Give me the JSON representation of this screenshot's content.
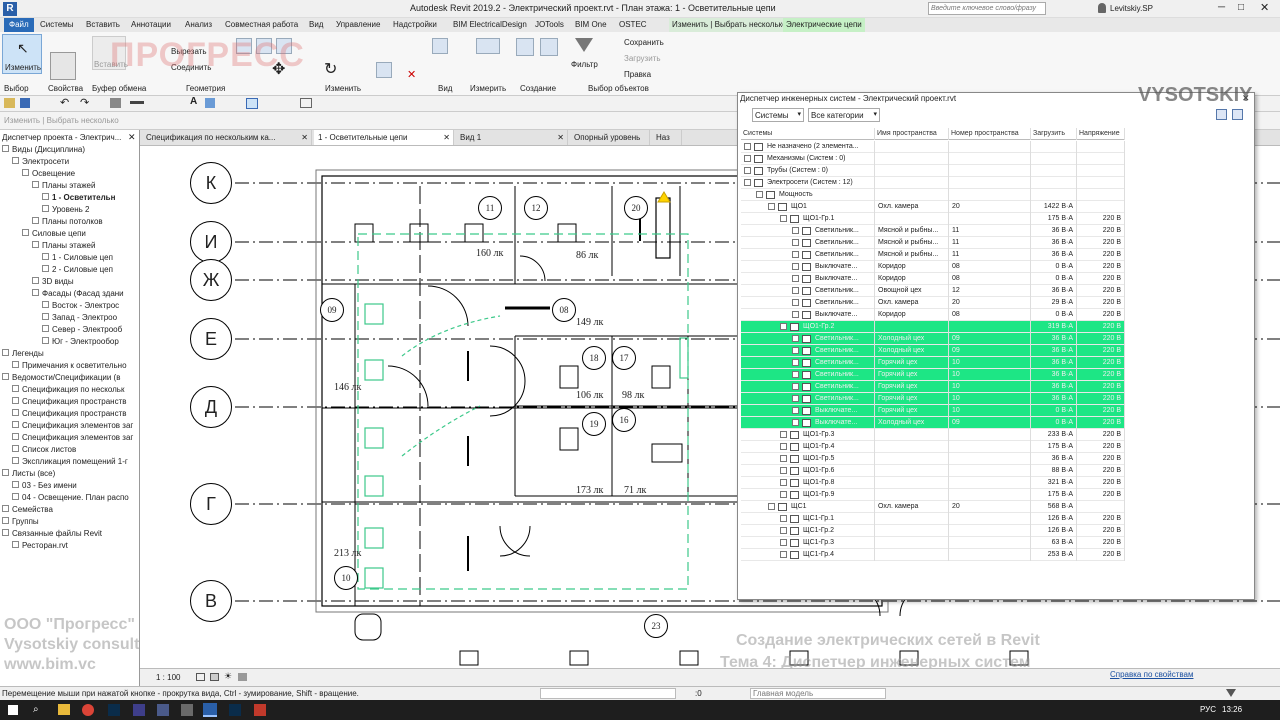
{
  "window": {
    "title": "Autodesk Revit 2019.2 - Электрический проект.rvt - План этажа: 1 - Осветительные цепи",
    "search_placeholder": "Введите ключевое слово/фразу",
    "user": "Levitskiy.SP"
  },
  "menu": [
    "Файл",
    "Системы",
    "Вставить",
    "Аннотации",
    "Анализ",
    "Совместная работа",
    "Вид",
    "Управление",
    "Надстройки",
    "BIM ElectricalDesign",
    "JOTools",
    "BIM One",
    "OSTEC",
    "Изменить | Выбрать несколько",
    "Электрические цепи"
  ],
  "ribbon": {
    "modify_label": "Изменить",
    "paste_label": "Вставить",
    "cut_label": "Вырезать",
    "join_label": "Соединить",
    "save_label": "Сохранить",
    "load_label": "Загрузить",
    "edit_label": "Правка",
    "filter_label": "Фильтр",
    "panels": [
      "Выбор",
      "Свойства",
      "Буфер обмена",
      "Геометрия",
      "Изменить",
      "Вид",
      "Измерить",
      "Создание",
      "Выбор объектов"
    ]
  },
  "optbar_text": "Изменить | Выбрать несколько",
  "browser": {
    "title": "Диспетчер проекта - Электрич...",
    "items": [
      {
        "t": "Виды (Дисциплина)",
        "d": 0,
        "sel": false
      },
      {
        "t": "Электросети",
        "d": 1,
        "sel": false
      },
      {
        "t": "Освещение",
        "d": 2,
        "sel": false
      },
      {
        "t": "Планы этажей",
        "d": 3,
        "sel": false
      },
      {
        "t": "1 - Осветительн",
        "d": 4,
        "sel": true
      },
      {
        "t": "Уровень 2",
        "d": 4,
        "sel": false
      },
      {
        "t": "Планы потолков",
        "d": 3,
        "sel": false
      },
      {
        "t": "Силовые цепи",
        "d": 2,
        "sel": false
      },
      {
        "t": "Планы этажей",
        "d": 3,
        "sel": false
      },
      {
        "t": "1 - Силовые цеп",
        "d": 4,
        "sel": false
      },
      {
        "t": "2 - Силовые цеп",
        "d": 4,
        "sel": false
      },
      {
        "t": "3D виды",
        "d": 3,
        "sel": false
      },
      {
        "t": "Фасады (Фасад здани",
        "d": 3,
        "sel": false
      },
      {
        "t": "Восток - Электрос",
        "d": 4,
        "sel": false
      },
      {
        "t": "Запад - Электроо",
        "d": 4,
        "sel": false
      },
      {
        "t": "Север - Электрооб",
        "d": 4,
        "sel": false
      },
      {
        "t": "Юг - Электрообор",
        "d": 4,
        "sel": false
      },
      {
        "t": "Легенды",
        "d": 0,
        "sel": false
      },
      {
        "t": "Примечания к осветительно",
        "d": 1,
        "sel": false
      },
      {
        "t": "Ведомости/Спецификации (в",
        "d": 0,
        "sel": false
      },
      {
        "t": "Спецификация по нескольк",
        "d": 1,
        "sel": false
      },
      {
        "t": "Спецификация пространств",
        "d": 1,
        "sel": false
      },
      {
        "t": "Спецификация пространств",
        "d": 1,
        "sel": false
      },
      {
        "t": "Спецификация элементов заг",
        "d": 1,
        "sel": false
      },
      {
        "t": "Спецификация элементов заг",
        "d": 1,
        "sel": false
      },
      {
        "t": "Список листов",
        "d": 1,
        "sel": false
      },
      {
        "t": "Экспликация помещений 1-г",
        "d": 1,
        "sel": false
      },
      {
        "t": "Листы (все)",
        "d": 0,
        "sel": false
      },
      {
        "t": "03 - Без имени",
        "d": 1,
        "sel": false
      },
      {
        "t": "04 - Освещение. План распо",
        "d": 1,
        "sel": false
      },
      {
        "t": "Семейства",
        "d": 0,
        "sel": false
      },
      {
        "t": "Группы",
        "d": 0,
        "sel": false
      },
      {
        "t": "Связанные файлы Revit",
        "d": 0,
        "sel": false
      },
      {
        "t": "Ресторан.rvt",
        "d": 1,
        "sel": false
      }
    ]
  },
  "tabs": [
    "Спецификация по нескольким ка...",
    "1 - Осветительные цепи",
    "Вид 1",
    "Опорный уровень",
    "Наз"
  ],
  "plan": {
    "grid": [
      "К",
      "И",
      "Ж",
      "Е",
      "Д",
      "Г",
      "В"
    ],
    "rooms": [
      "11",
      "12",
      "20",
      "09",
      "08",
      "18",
      "17",
      "19",
      "16",
      "10",
      "23"
    ],
    "lux": [
      "160 лк",
      "86 лк",
      "149 лк",
      "146 лк",
      "106 лк",
      "98 лк",
      "173 лк",
      "71 лк",
      "213 лк"
    ],
    "scale": "1 : 100"
  },
  "sysmgr": {
    "title": "Диспетчер инженерных систем - Электрический проект.rvt",
    "filter1": "Системы",
    "filter2": "Все категории",
    "headers": [
      "Системы",
      "Имя пространства",
      "Номер пространства",
      "Загрузить",
      "Напряжение"
    ],
    "rows": [
      {
        "d": 0,
        "n": "Не назначено (2 элемента...",
        "s": "",
        "num": "",
        "load": "",
        "v": "",
        "hl": false
      },
      {
        "d": 0,
        "n": "Механизмы (Систем : 0)",
        "s": "",
        "num": "",
        "load": "",
        "v": "",
        "hl": false
      },
      {
        "d": 0,
        "n": "Трубы (Систем : 0)",
        "s": "",
        "num": "",
        "load": "",
        "v": "",
        "hl": false
      },
      {
        "d": 0,
        "n": "Электросети (Систем : 12)",
        "s": "",
        "num": "",
        "load": "",
        "v": "",
        "hl": false
      },
      {
        "d": 1,
        "n": "Мощность",
        "s": "",
        "num": "",
        "load": "",
        "v": "",
        "hl": false
      },
      {
        "d": 2,
        "n": "ЩО1",
        "s": "Охл. камера",
        "num": "20",
        "load": "1422 В·А",
        "v": "",
        "hl": false
      },
      {
        "d": 3,
        "n": "ЩО1-Гр.1",
        "s": "",
        "num": "",
        "load": "175 В·А",
        "v": "220 В",
        "hl": false
      },
      {
        "d": 4,
        "n": "Светильник...",
        "s": "Мясной и рыбны...",
        "num": "11",
        "load": "36 В·А",
        "v": "220 В",
        "hl": false
      },
      {
        "d": 4,
        "n": "Светильник...",
        "s": "Мясной и рыбны...",
        "num": "11",
        "load": "36 В·А",
        "v": "220 В",
        "hl": false
      },
      {
        "d": 4,
        "n": "Светильник...",
        "s": "Мясной и рыбны...",
        "num": "11",
        "load": "36 В·А",
        "v": "220 В",
        "hl": false
      },
      {
        "d": 4,
        "n": "Выключате...",
        "s": "Коридор",
        "num": "08",
        "load": "0 В·А",
        "v": "220 В",
        "hl": false
      },
      {
        "d": 4,
        "n": "Выключате...",
        "s": "Коридор",
        "num": "08",
        "load": "0 В·А",
        "v": "220 В",
        "hl": false
      },
      {
        "d": 4,
        "n": "Светильник...",
        "s": "Овощной цех",
        "num": "12",
        "load": "36 В·А",
        "v": "220 В",
        "hl": false
      },
      {
        "d": 4,
        "n": "Светильник...",
        "s": "Охл. камера",
        "num": "20",
        "load": "29 В·А",
        "v": "220 В",
        "hl": false
      },
      {
        "d": 4,
        "n": "Выключате...",
        "s": "Коридор",
        "num": "08",
        "load": "0 В·А",
        "v": "220 В",
        "hl": false
      },
      {
        "d": 3,
        "n": "ЩО1-Гр.2",
        "s": "",
        "num": "",
        "load": "319 В·А",
        "v": "220 В",
        "hl": true
      },
      {
        "d": 4,
        "n": "Светильник...",
        "s": "Холодный цех",
        "num": "09",
        "load": "36 В·А",
        "v": "220 В",
        "hl": true
      },
      {
        "d": 4,
        "n": "Светильник...",
        "s": "Холодный цех",
        "num": "09",
        "load": "36 В·А",
        "v": "220 В",
        "hl": true
      },
      {
        "d": 4,
        "n": "Светильник...",
        "s": "Горячий цех",
        "num": "10",
        "load": "36 В·А",
        "v": "220 В",
        "hl": true
      },
      {
        "d": 4,
        "n": "Светильник...",
        "s": "Горячий цех",
        "num": "10",
        "load": "36 В·А",
        "v": "220 В",
        "hl": true
      },
      {
        "d": 4,
        "n": "Светильник...",
        "s": "Горячий цех",
        "num": "10",
        "load": "36 В·А",
        "v": "220 В",
        "hl": true
      },
      {
        "d": 4,
        "n": "Светильник...",
        "s": "Горячий цех",
        "num": "10",
        "load": "36 В·А",
        "v": "220 В",
        "hl": true
      },
      {
        "d": 4,
        "n": "Выключате...",
        "s": "Горячий цех",
        "num": "10",
        "load": "0 В·А",
        "v": "220 В",
        "hl": true
      },
      {
        "d": 4,
        "n": "Выключате...",
        "s": "Холодный цех",
        "num": "09",
        "load": "0 В·А",
        "v": "220 В",
        "hl": true
      },
      {
        "d": 3,
        "n": "ЩО1-Гр.3",
        "s": "",
        "num": "",
        "load": "233 В·А",
        "v": "220 В",
        "hl": false
      },
      {
        "d": 3,
        "n": "ЩО1-Гр.4",
        "s": "",
        "num": "",
        "load": "175 В·А",
        "v": "220 В",
        "hl": false
      },
      {
        "d": 3,
        "n": "ЩО1-Гр.5",
        "s": "",
        "num": "",
        "load": "36 В·А",
        "v": "220 В",
        "hl": false
      },
      {
        "d": 3,
        "n": "ЩО1-Гр.6",
        "s": "",
        "num": "",
        "load": "88 В·А",
        "v": "220 В",
        "hl": false
      },
      {
        "d": 3,
        "n": "ЩО1-Гр.8",
        "s": "",
        "num": "",
        "load": "321 В·А",
        "v": "220 В",
        "hl": false
      },
      {
        "d": 3,
        "n": "ЩО1-Гр.9",
        "s": "",
        "num": "",
        "load": "175 В·А",
        "v": "220 В",
        "hl": false
      },
      {
        "d": 2,
        "n": "ЩС1",
        "s": "Охл. камера",
        "num": "20",
        "load": "568 В·А",
        "v": "",
        "hl": false
      },
      {
        "d": 3,
        "n": "ЩС1-Гр.1",
        "s": "",
        "num": "",
        "load": "126 В·А",
        "v": "220 В",
        "hl": false
      },
      {
        "d": 3,
        "n": "ЩС1-Гр.2",
        "s": "",
        "num": "",
        "load": "126 В·А",
        "v": "220 В",
        "hl": false
      },
      {
        "d": 3,
        "n": "ЩС1-Гр.3",
        "s": "",
        "num": "",
        "load": "63 В·А",
        "v": "220 В",
        "hl": false
      },
      {
        "d": 3,
        "n": "ЩС1-Гр.4",
        "s": "",
        "num": "",
        "load": "253 В·А",
        "v": "220 В",
        "hl": false
      }
    ]
  },
  "watermark": {
    "company": "ООО \"Прогресс\"",
    "consulting": "Vysotskiy consulting",
    "site": "www.bim.vc",
    "topic1": "Создание электрических сетей в Revit",
    "topic2": "Тема 4: Диспетчер инженерных систем",
    "brand": "VYSOTSKIY",
    "logo": "ПРОГРЕСС"
  },
  "status": {
    "hint": "Перемещение мыши при нажатой кнопке - прокрутка вида, Ctrl - зумирование, Shift - вращение.",
    "model": "Главная модель",
    "props_link": "Справка по свойствам",
    "zero": ":0"
  },
  "taskbar": {
    "lang": "РУС",
    "time": "13:26"
  },
  "colors": {
    "highlight": "#1de685",
    "accent_tab": "#c6f0c6"
  }
}
